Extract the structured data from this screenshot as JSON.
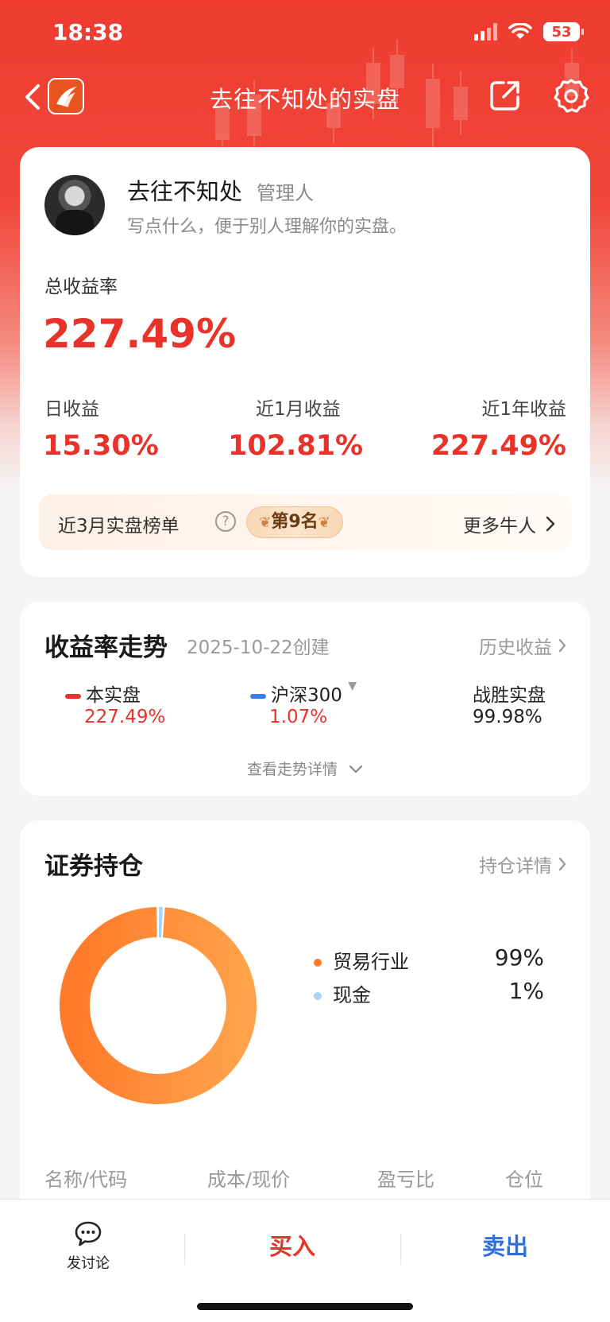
{
  "status_bar": {
    "time": "18:38",
    "battery": "53"
  },
  "nav": {
    "title": "去往不知处的实盘"
  },
  "profile": {
    "name": "去往不知处",
    "role": "管理人",
    "description": "写点什么，便于别人理解你的实盘。"
  },
  "returns": {
    "total_label": "总收益率",
    "total_value": "227.49%",
    "daily_label": "日收益",
    "daily_value": "15.30%",
    "month_label": "近1月收益",
    "month_value": "102.81%",
    "year_label": "近1年收益",
    "year_value": "227.49%"
  },
  "ranking": {
    "label": "近3月实盘榜单",
    "badge": "第9名",
    "more": "更多牛人"
  },
  "trend": {
    "title": "收益率走势",
    "created": "2025-10-22创建",
    "history_link": "历史收益",
    "series": [
      {
        "name": "本实盘",
        "value": "227.49%",
        "color": "#e8322a"
      },
      {
        "name": "沪深300",
        "value": "1.07%",
        "color": "#3b7ded"
      },
      {
        "name": "战胜实盘",
        "value": "99.98%",
        "color": "#222222"
      }
    ],
    "view_more": "查看走势详情"
  },
  "holdings": {
    "title": "证券持仓",
    "detail_link": "持仓详情",
    "allocation": [
      {
        "name": "贸易行业",
        "pct": "99%",
        "share": 0.99,
        "color": "#ff7a2a"
      },
      {
        "name": "现金",
        "pct": "1%",
        "share": 0.01,
        "color": "#a8d4f5"
      }
    ],
    "columns": [
      "名称/代码",
      "成本/现价",
      "盈亏比",
      "仓位"
    ]
  },
  "bottom": {
    "discuss": "发讨论",
    "buy": "买入",
    "sell": "卖出"
  }
}
